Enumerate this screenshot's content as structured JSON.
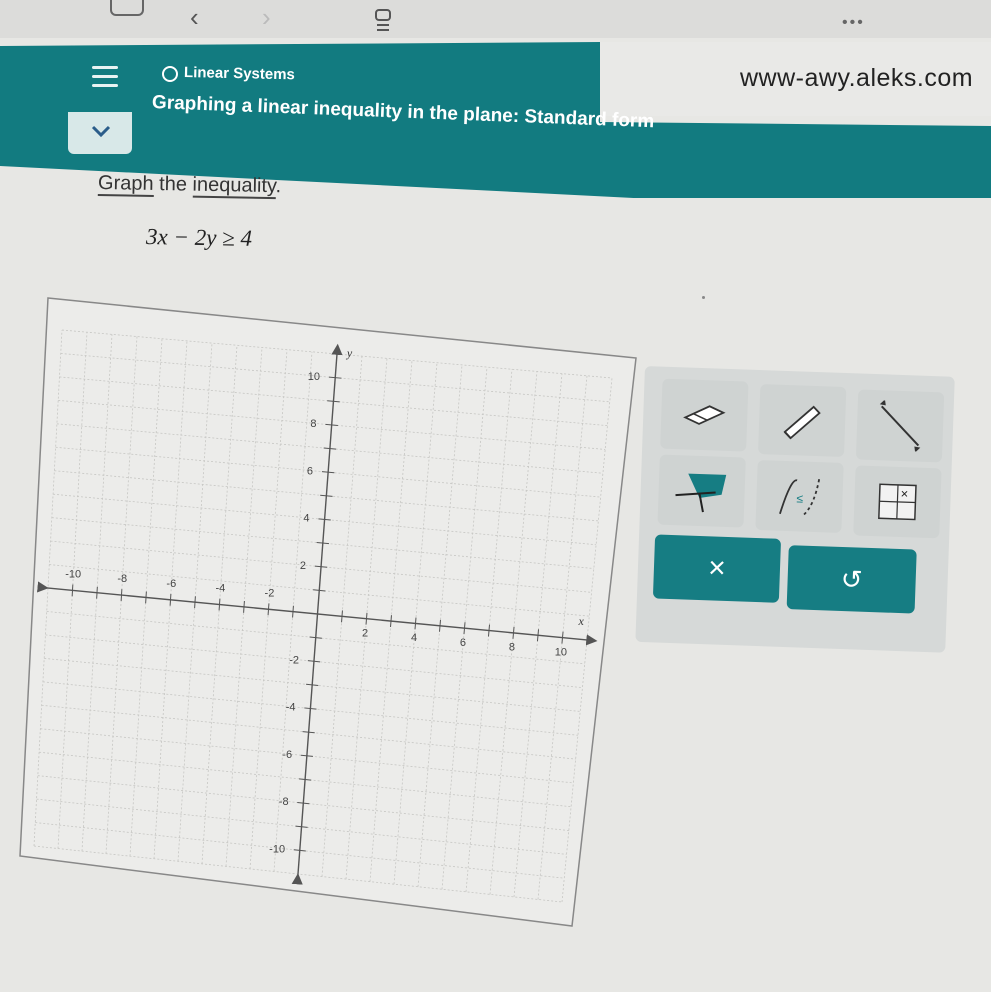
{
  "browser": {
    "url": "www-awy.aleks.com"
  },
  "header": {
    "topic": "Linear Systems",
    "lesson": "Graphing a linear inequality in the plane: Standard form"
  },
  "problem": {
    "prompt_word1": "Graph",
    "prompt_word2": "the",
    "prompt_word3": "inequality",
    "prompt_end": ".",
    "equation": "3x − 2y ≥ 4"
  },
  "graph": {
    "x_label": "x",
    "y_label": "y",
    "range": [
      -10,
      10
    ],
    "x_ticks": [
      "-10",
      "-8",
      "-6",
      "-4",
      "-2",
      "2",
      "4",
      "6",
      "8",
      "10"
    ],
    "y_ticks": [
      "10",
      "8",
      "6",
      "4",
      "2",
      "-2",
      "-4",
      "-6",
      "-8",
      "-10"
    ]
  },
  "tools": {
    "clear_symbol": "×",
    "undo_symbol": "↺"
  },
  "colors": {
    "teal": "#127b80",
    "button": "#167d83"
  },
  "icons": [
    "menu-icon",
    "chevron-down-icon",
    "eraser-icon",
    "pencil-icon",
    "line-segment-icon",
    "region-shade-icon",
    "parabola-icon",
    "plot-point-icon",
    "close-icon",
    "undo-icon"
  ]
}
